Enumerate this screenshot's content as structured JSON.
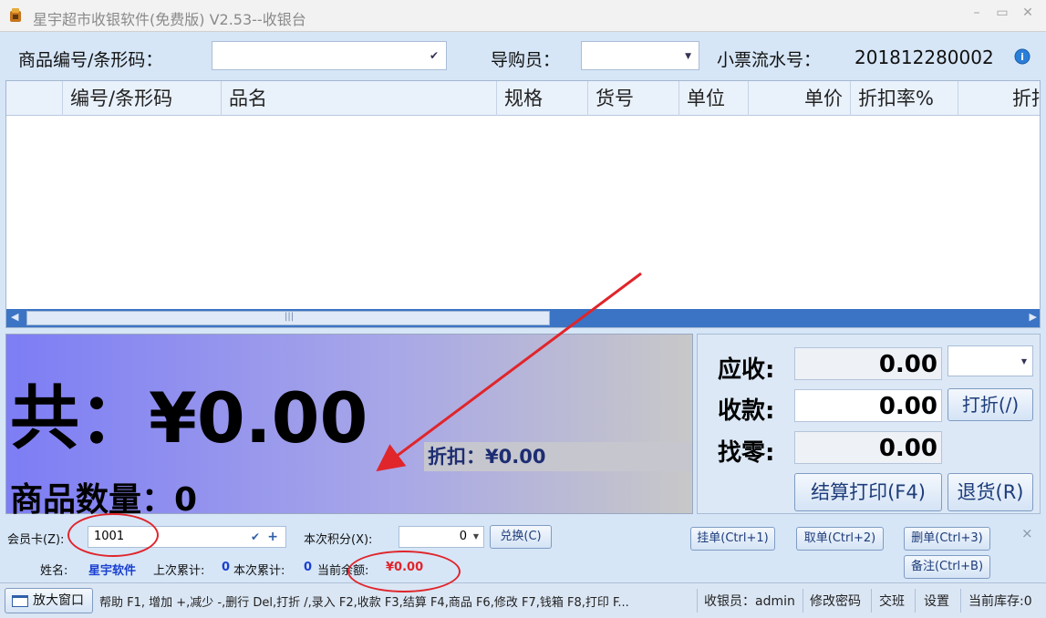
{
  "window": {
    "title": "星宇超市收银软件(免费版) V2.53--收银台",
    "minimize": "–",
    "maximize": "▭",
    "close": "✕"
  },
  "top": {
    "barcode_label": "商品编号/条形码：",
    "barcode_value": "",
    "guide_label": "导购员：",
    "guide_value": "",
    "ticket_label": "小票流水号：",
    "ticket_value": "201812280002"
  },
  "grid": {
    "columns": [
      "编号/条形码",
      "品名",
      "规格",
      "货号",
      "单位",
      "单价",
      "折扣率%",
      "折扣价"
    ],
    "rows": []
  },
  "totals": {
    "total_text": "共：¥0.00",
    "quantity_text": "商品数量：0",
    "discount_text": "折扣：¥0.00"
  },
  "payment": {
    "receivable_label": "应收:",
    "receivable_value": "0.00",
    "received_label": "收款:",
    "received_value": "0.00",
    "change_label": "找零:",
    "change_value": "0.00",
    "discount_button": "打折(/)",
    "checkout_button": "结算打印(F4)",
    "return_button": "退货(R)"
  },
  "member": {
    "card_label": "会员卡(Z):",
    "card_value": "1001",
    "points_label": "本次积分(X):",
    "points_value": "0",
    "redeem_button": "兑换(C)",
    "name_label": "姓名:",
    "name_value": "星宇软件",
    "last_total_label": "上次累计:",
    "last_total_value": "0",
    "this_total_label": "本次累计:",
    "this_total_value": "0",
    "balance_label": "当前余额:",
    "balance_value": "¥0.00"
  },
  "actions": {
    "hold": "挂单(Ctrl+1)",
    "retrieve": "取单(Ctrl+2)",
    "delete": "删单(Ctrl+3)",
    "note": "备注(Ctrl+B)",
    "close_x": "×"
  },
  "status": {
    "enlarge": "放大窗口",
    "help": "帮助 F1, 增加 +,减少 -,删行 Del,打折 /,录入 F2,收款 F3,结算 F4,商品 F6,修改 F7,钱箱 F8,打印 F...",
    "cashier": "收银员：admin",
    "change_password": "修改密码",
    "shift": "交班",
    "settings": "设置",
    "stock": "当前库存:0"
  },
  "colors": {
    "accent": "#3b74c4",
    "annotation": "#e0252b",
    "member_name": "#1a3fd0",
    "balance": "#e0252b"
  }
}
